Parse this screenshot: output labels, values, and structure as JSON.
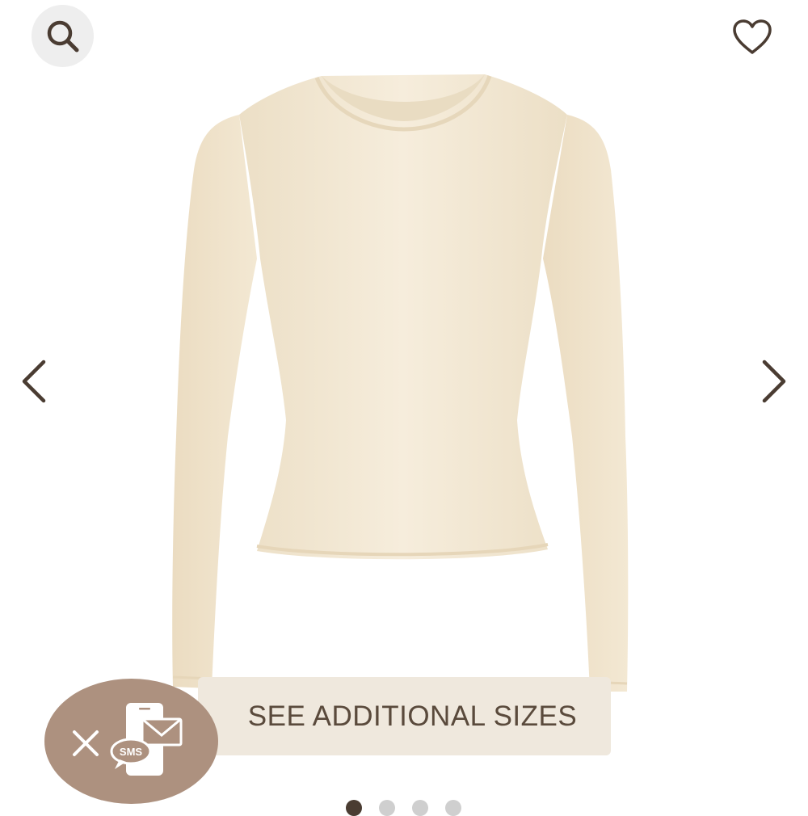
{
  "product": {
    "image_description_icon": "long-sleeve-tee-image",
    "shirt_color": "#f4ead8"
  },
  "toolbar": {
    "search_icon": "search-icon",
    "wishlist_icon": "heart-icon"
  },
  "carousel": {
    "prev_icon": "chevron-left-icon",
    "next_icon": "chevron-right-icon",
    "slide_count": 4,
    "active_slide": 1
  },
  "sizes_button": {
    "label": "SEE ADDITIONAL SIZES"
  },
  "sms_popup": {
    "close_icon": "close-icon",
    "badge_label": "SMS",
    "bubble_color": "#ad917f"
  }
}
